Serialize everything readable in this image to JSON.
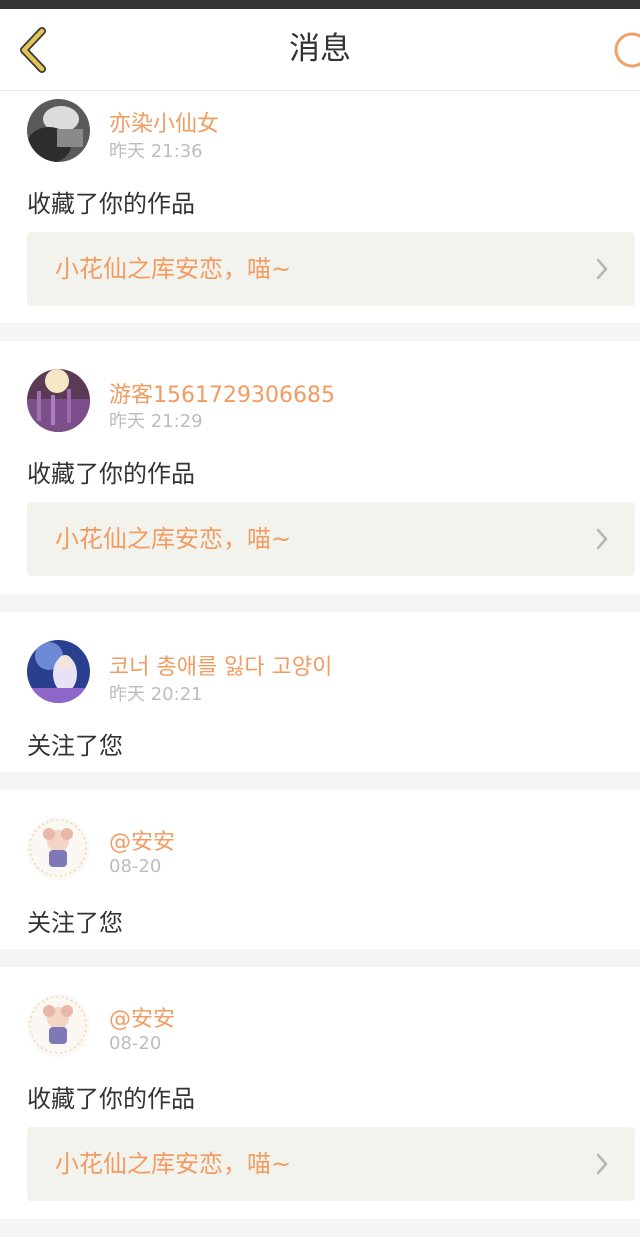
{
  "header": {
    "title": "消息"
  },
  "notifications": [
    {
      "user": "亦染小仙女",
      "time": "昨天 21:36",
      "action": "收藏了你的作品",
      "work": "小花仙之库安恋，喵~"
    },
    {
      "user": "游客1561729306685",
      "time": "昨天 21:29",
      "action": "收藏了你的作品",
      "work": "小花仙之库安恋，喵~"
    },
    {
      "user": "코너 총애를 잃다 고양이",
      "time": "昨天 20:21",
      "action": "关注了您"
    },
    {
      "user": "@安安",
      "time": "08-20",
      "action": "关注了您"
    },
    {
      "user": "@安安",
      "time": "08-20",
      "action": "收藏了你的作品",
      "work": "小花仙之库安恋，喵~"
    }
  ],
  "colors": {
    "accent": "#f29b62",
    "back_icon": "#e2c552",
    "search_icon": "#f2a06a"
  },
  "icons": {
    "back": "chevron-left-icon",
    "search": "search-icon",
    "link": "chevron-right-icon"
  }
}
